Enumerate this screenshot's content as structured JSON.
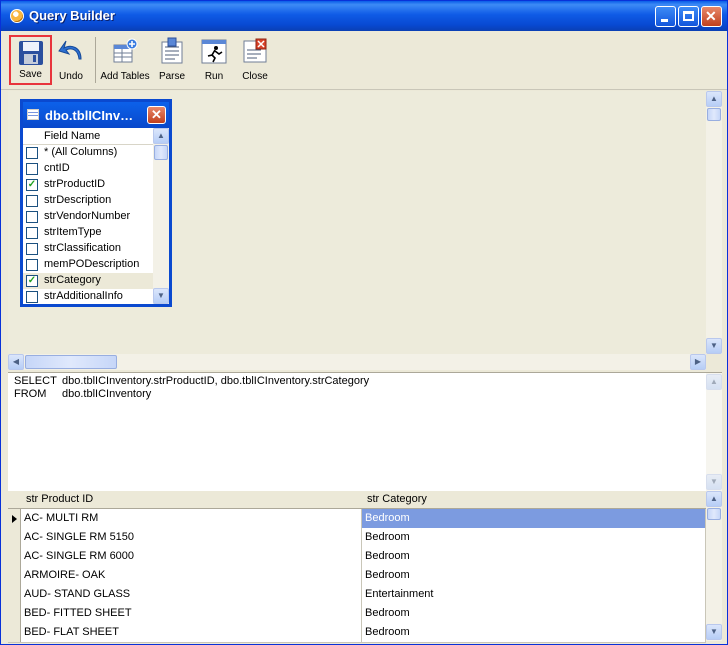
{
  "window": {
    "title": "Query Builder"
  },
  "toolbar": {
    "buttons": [
      {
        "id": "save",
        "label": "Save"
      },
      {
        "id": "undo",
        "label": "Undo"
      },
      {
        "id": "add_tables",
        "label": "Add Tables"
      },
      {
        "id": "parse",
        "label": "Parse"
      },
      {
        "id": "run",
        "label": "Run"
      },
      {
        "id": "close",
        "label": "Close"
      }
    ]
  },
  "table_box": {
    "title": "dbo.tblICInv…",
    "header": "Field Name",
    "fields": [
      {
        "name": "* (All Columns)",
        "checked": false
      },
      {
        "name": "cntID",
        "checked": false
      },
      {
        "name": "strProductID",
        "checked": true
      },
      {
        "name": "strDescription",
        "checked": false
      },
      {
        "name": "strVendorNumber",
        "checked": false
      },
      {
        "name": "strItemType",
        "checked": false
      },
      {
        "name": "strClassification",
        "checked": false
      },
      {
        "name": "memPODescription",
        "checked": false
      },
      {
        "name": "strCategory",
        "checked": true
      },
      {
        "name": "strAdditionalInfo",
        "checked": false
      }
    ]
  },
  "sql": {
    "select_kw": "SELECT",
    "select_cols": "dbo.tblICInventory.strProductID, dbo.tblICInventory.strCategory",
    "from_kw": "FROM",
    "from_table": "dbo.tblICInventory"
  },
  "grid": {
    "columns": [
      "str Product ID",
      "str Category"
    ],
    "rows": [
      [
        "AC- MULTI RM",
        "Bedroom"
      ],
      [
        "AC- SINGLE RM 5150",
        "Bedroom"
      ],
      [
        "AC- SINGLE RM 6000",
        "Bedroom"
      ],
      [
        "ARMOIRE- OAK",
        "Bedroom"
      ],
      [
        "AUD- STAND GLASS",
        "Entertainment"
      ],
      [
        "BED- FITTED SHEET",
        "Bedroom"
      ],
      [
        "BED- FLAT SHEET",
        "Bedroom"
      ]
    ]
  }
}
